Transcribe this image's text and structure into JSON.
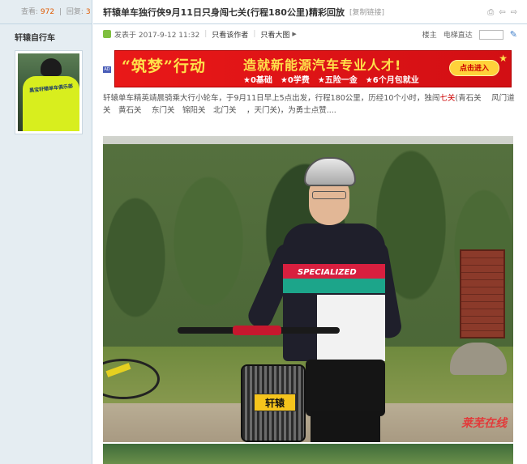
{
  "left": {
    "views_label": "查看:",
    "views": "972",
    "sep": "|",
    "replies_label": "回复:",
    "replies": "3",
    "author": "轩辕自行车",
    "avatar_text": "黑宝轩辕单车俱乐部"
  },
  "post": {
    "title": "轩辕单车独行侠9月11日只身闯七关(行程180公里)精彩回放",
    "copy_link": "[复制链接]",
    "posted_on": "发表于 2017-9-12 11:32",
    "only_author": "只看该作者",
    "only_images": "只看大图",
    "floor": "楼主",
    "jump_label": "电梯直达",
    "text_part1": "轩辕单车精英靖晨骑乘大行小轮车，于9月11日早上5点出发，行程180公里，历经10个小时，独闯",
    "text_hl": "七关",
    "text_part2": "(青石关　 风门道关　黄石关　 东门关　锦阳关　北门关　 ，天门关)，为勇士点赞....",
    "watermark": "莱芜在线"
  },
  "banner": {
    "ad_tag": "AD",
    "slogan1": "“筑梦”行动",
    "slogan2": "造就新能源汽车专业人才!",
    "slogan3": "★0基础　★0学费　★五险一金　★6个月包就业",
    "button": "点击进入"
  },
  "photo": {
    "jersey_text": "SPECIALIZED",
    "basket_label": "轩辕"
  }
}
